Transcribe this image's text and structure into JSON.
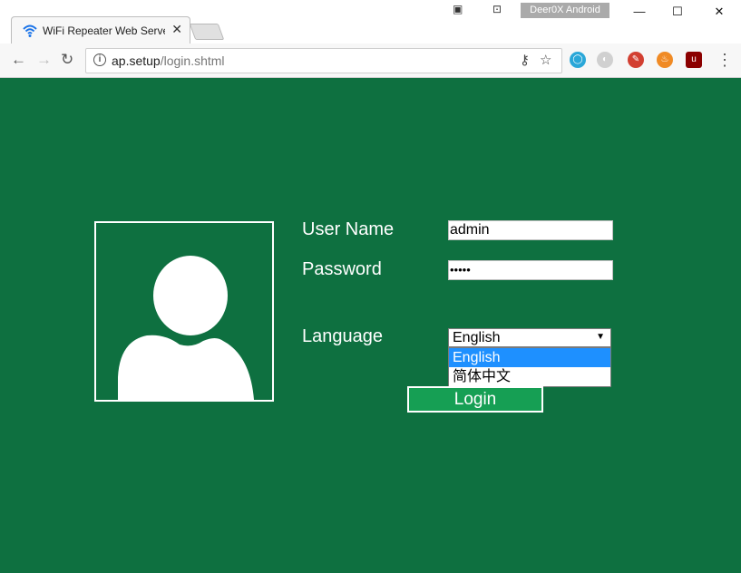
{
  "browser": {
    "tab_title": "WiFi Repeater Web Server",
    "tab_close": "✕",
    "profile_name": "Deer0X Android",
    "url_host": "ap.setup",
    "url_path": "/login.shtml",
    "icons": {
      "back": "arrow-left",
      "forward": "arrow-right",
      "reload": "reload",
      "info": "info",
      "key": "key",
      "star": "star",
      "menu": "three-dots"
    },
    "window_controls": {
      "minimize": "—",
      "maximize": "☐",
      "close": "✕"
    }
  },
  "login": {
    "username_label": "User Name",
    "username_value": "admin",
    "password_label": "Password",
    "password_value": "•••••",
    "language_label": "Language",
    "language_selected": "English",
    "language_options": [
      "English",
      "简体中文"
    ],
    "login_button": "Login"
  },
  "colors": {
    "page_bg": "#0e7040",
    "button_bg": "#169f54",
    "dropdown_highlight": "#1e90ff"
  }
}
